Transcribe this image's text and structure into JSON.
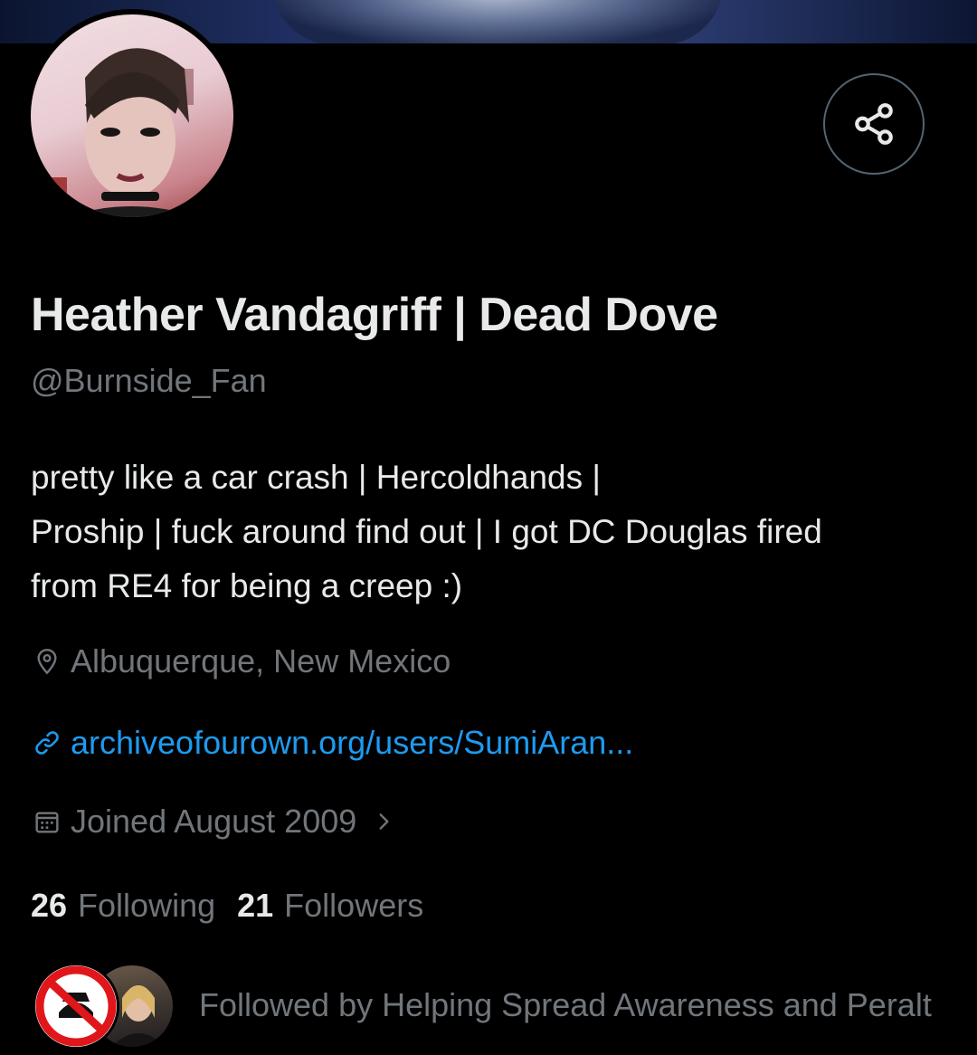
{
  "profile": {
    "display_name": "Heather Vandagriff | Dead Dove",
    "handle": "@Burnside_Fan",
    "bio_lines": [
      "pretty like a car crash | Hercoldhands |",
      "Proship | fuck around find out | I got DC Douglas fired",
      "from RE4 for being a creep :)"
    ],
    "location": "Albuquerque, New Mexico",
    "link": "archiveofourown.org/users/SumiAran...",
    "joined": "Joined August 2009"
  },
  "stats": {
    "following_count": "26",
    "following_label": "Following",
    "followers_count": "21",
    "followers_label": "Followers"
  },
  "followed_by": {
    "text": "Followed by Helping Spread Awareness and Peralt"
  },
  "icons": {
    "share": "share-icon",
    "location": "location-pin-icon",
    "link": "link-icon",
    "calendar": "calendar-icon",
    "chevron": "chevron-right-icon"
  },
  "colors": {
    "background": "#000000",
    "text_primary": "#e7e9ea",
    "text_secondary": "#71767b",
    "link": "#1d9bf0",
    "border": "#536471"
  }
}
